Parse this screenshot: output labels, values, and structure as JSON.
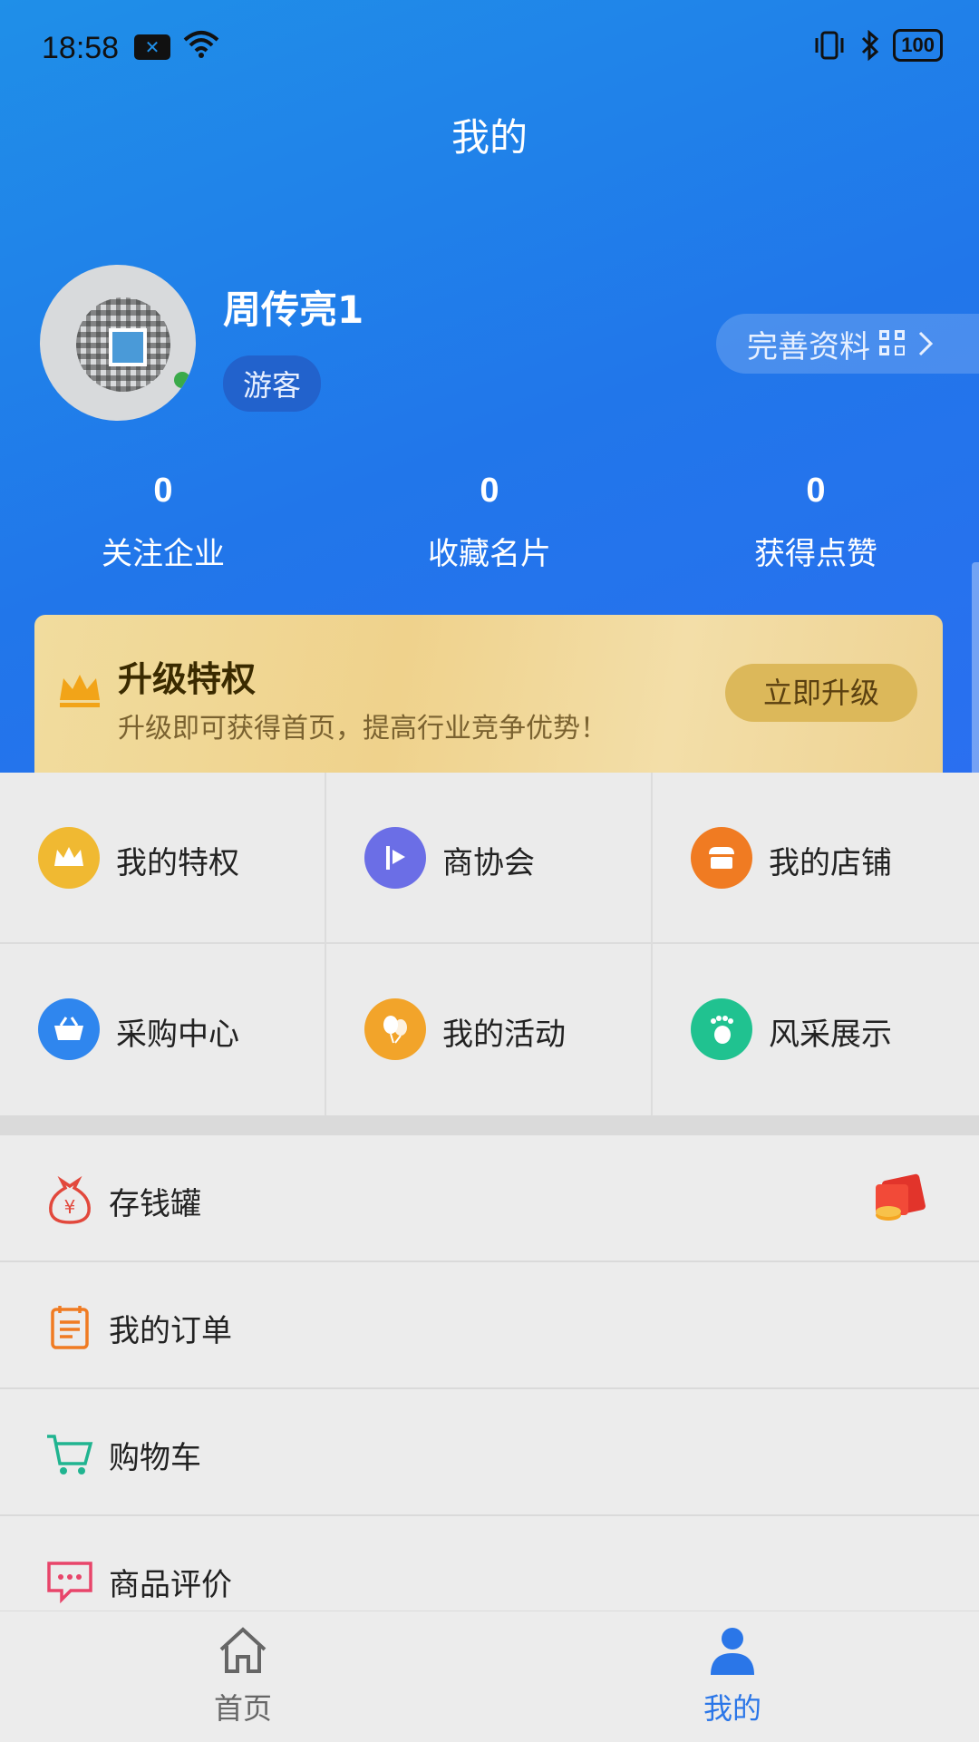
{
  "status_bar": {
    "time": "18:58",
    "battery": "100"
  },
  "header": {
    "title": "我的"
  },
  "profile": {
    "name": "周传亮1",
    "role": "游客",
    "complete_label": "完善资料"
  },
  "stats": [
    {
      "value": "0",
      "label": "关注企业"
    },
    {
      "value": "0",
      "label": "收藏名片"
    },
    {
      "value": "0",
      "label": "获得点赞"
    }
  ],
  "upgrade": {
    "title": "升级特权",
    "description": "升级即可获得首页，提高行业竞争优势！",
    "button": "立即升级"
  },
  "grid_items": [
    {
      "label": "我的特权",
      "icon": "crown-icon",
      "color": "#f0b932"
    },
    {
      "label": "商协会",
      "icon": "flag-icon",
      "color": "#6b6ee6"
    },
    {
      "label": "我的店铺",
      "icon": "shop-icon",
      "color": "#f07b22"
    },
    {
      "label": "采购中心",
      "icon": "basket-icon",
      "color": "#2f86ee"
    },
    {
      "label": "我的活动",
      "icon": "balloons-icon",
      "color": "#f2a42a"
    },
    {
      "label": "风采展示",
      "icon": "footprint-icon",
      "color": "#20c290"
    }
  ],
  "list_items": [
    {
      "label": "存钱罐",
      "icon": "money-bag-icon"
    },
    {
      "label": "我的订单",
      "icon": "order-icon"
    },
    {
      "label": "购物车",
      "icon": "cart-icon"
    },
    {
      "label": "商品评价",
      "icon": "comment-icon"
    }
  ],
  "tabbar": {
    "home": "首页",
    "mine": "我的"
  },
  "colors": {
    "accent": "#2a76e8",
    "hero_start": "#1f8fe8",
    "gold": "#dcb85a"
  }
}
